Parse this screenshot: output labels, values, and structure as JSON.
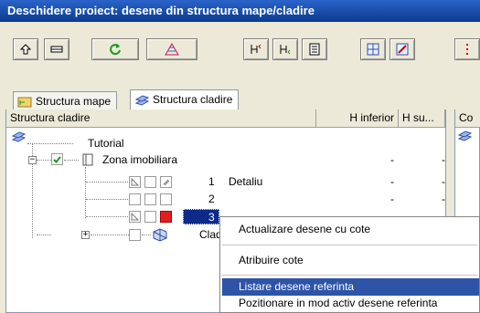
{
  "window": {
    "title": "Deschidere proiect: desene din structura mape/cladire"
  },
  "toolbar": {
    "buttons": [
      {
        "name": "open-tool-icon"
      },
      {
        "name": "pan-tool-icon"
      },
      {
        "name": "refresh-icon"
      },
      {
        "name": "hatch-icon"
      },
      {
        "name": "tree-add-icon"
      },
      {
        "name": "tree-link-icon"
      },
      {
        "name": "tree-list-icon"
      },
      {
        "name": "grid-edit-icon"
      },
      {
        "name": "grid-settings-icon"
      },
      {
        "name": "more-options-icon"
      }
    ]
  },
  "tabs": [
    {
      "label": "Structura mape",
      "active": false
    },
    {
      "label": "Structura cladire",
      "active": true
    }
  ],
  "columns": {
    "name": "Structura cladire",
    "h_inferior": "H inferior",
    "h_superior": "H su...",
    "side": "Co"
  },
  "tree": {
    "root": "Tutorial",
    "zone": {
      "label": "Zona imobiliara",
      "h_inf": "-",
      "h_sup": "-"
    },
    "rows": [
      {
        "num": "1",
        "label": "Detaliu",
        "h_inf": "-",
        "h_sup": "-"
      },
      {
        "num": "2",
        "label": "",
        "h_inf": "-",
        "h_sup": "-"
      },
      {
        "num": "3",
        "label": "",
        "h_inf": "",
        "h_sup": ""
      }
    ],
    "next": {
      "label": "Clad"
    }
  },
  "context_menu": {
    "items": [
      "Actualizare desene cu cote",
      "Atribuire cote",
      "Listare desene referinta",
      "Pozitionare in mod activ desene referinta"
    ],
    "highlighted_index": 2
  },
  "colors": {
    "titlebar": "#0b3b8e",
    "selection": "#2e54a8",
    "frame": "#ece9d8"
  }
}
